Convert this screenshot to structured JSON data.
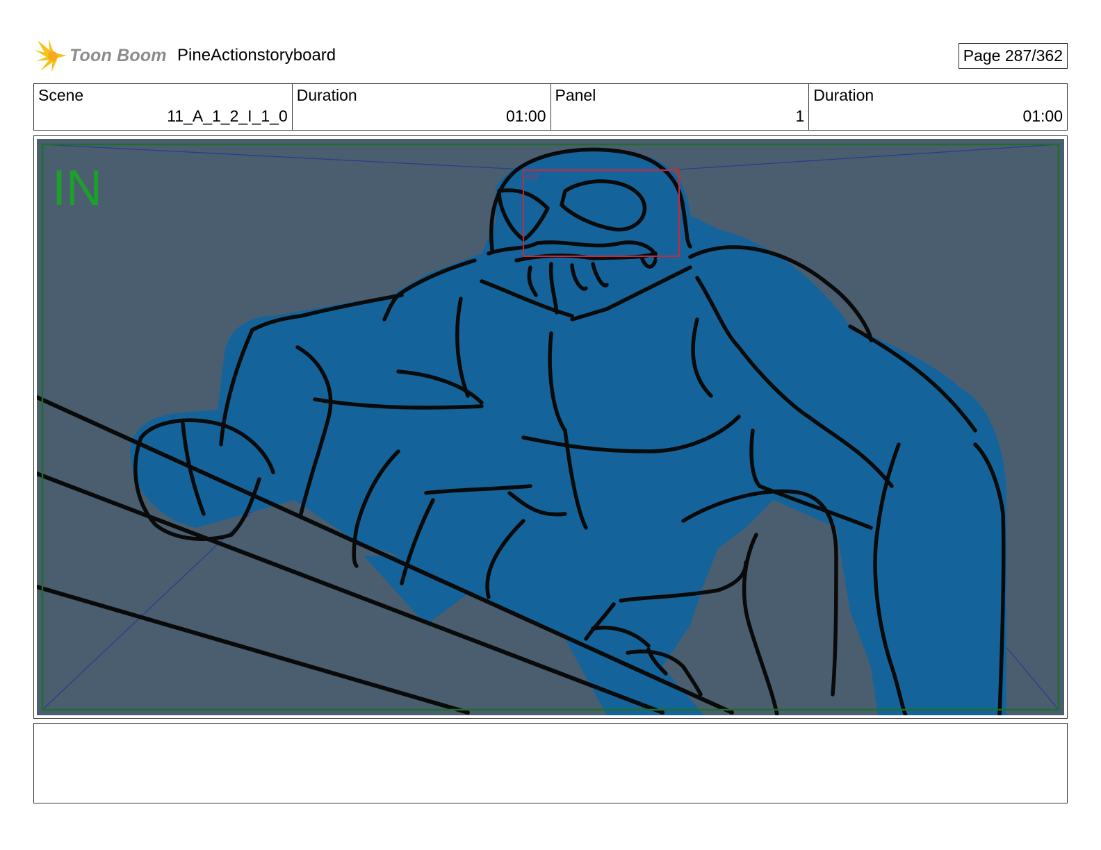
{
  "header": {
    "logo_text": "Toon Boom",
    "project_title": "PineActionstoryboard",
    "page_label": "Page 287/362"
  },
  "info": {
    "scene_label": "Scene",
    "scene_value": "11_A_1_2_I_1_0",
    "scene_duration_label": "Duration",
    "scene_duration_value": "01:00",
    "panel_label": "Panel",
    "panel_value": "1",
    "panel_duration_label": "Duration",
    "panel_duration_value": "01:00"
  },
  "panel": {
    "in_marker": "IN",
    "out_marker": "out"
  },
  "colors": {
    "background_slate": "#4a5e70",
    "creature_blue": "#14649b",
    "ink": "#0a0a0a",
    "camera_in_green": "#1e9e2a",
    "camera_out_red": "#c8283c",
    "guide_blue": "#2d3c8c"
  },
  "notes": {
    "text": ""
  }
}
